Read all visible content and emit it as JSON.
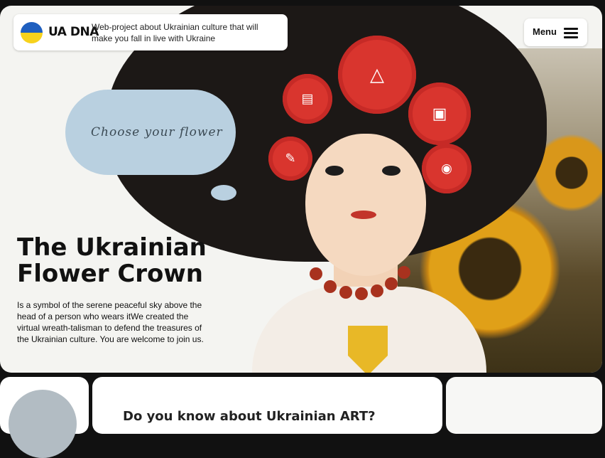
{
  "header": {
    "logo_text": "UA DNA",
    "tagline": "Web-project about Ukrainian culture that will make you fall in live with Ukraine",
    "menu_label": "Menu"
  },
  "hero": {
    "cloud_text": "Choose your flower",
    "title_line1": "The Ukrainian",
    "title_line2": "Flower Crown",
    "description": "Is a symbol of the serene peaceful sky above the head of a person who wears itWe created the virtual wreath-talisman to defend the treasures of the Ukrainian culture. You are welcome to join us.",
    "flower_icons": [
      "clapperboard-icon",
      "dress-icon",
      "camera-icon",
      "pen-icon",
      "headphones-icon"
    ]
  },
  "cards": {
    "art_question": "Do you know about Ukrainian ART?"
  },
  "colors": {
    "flag_blue": "#1f5fbf",
    "flag_yellow": "#f7d21c",
    "flower_red": "#d9352e",
    "cloud_blue": "#b9d0e0"
  }
}
